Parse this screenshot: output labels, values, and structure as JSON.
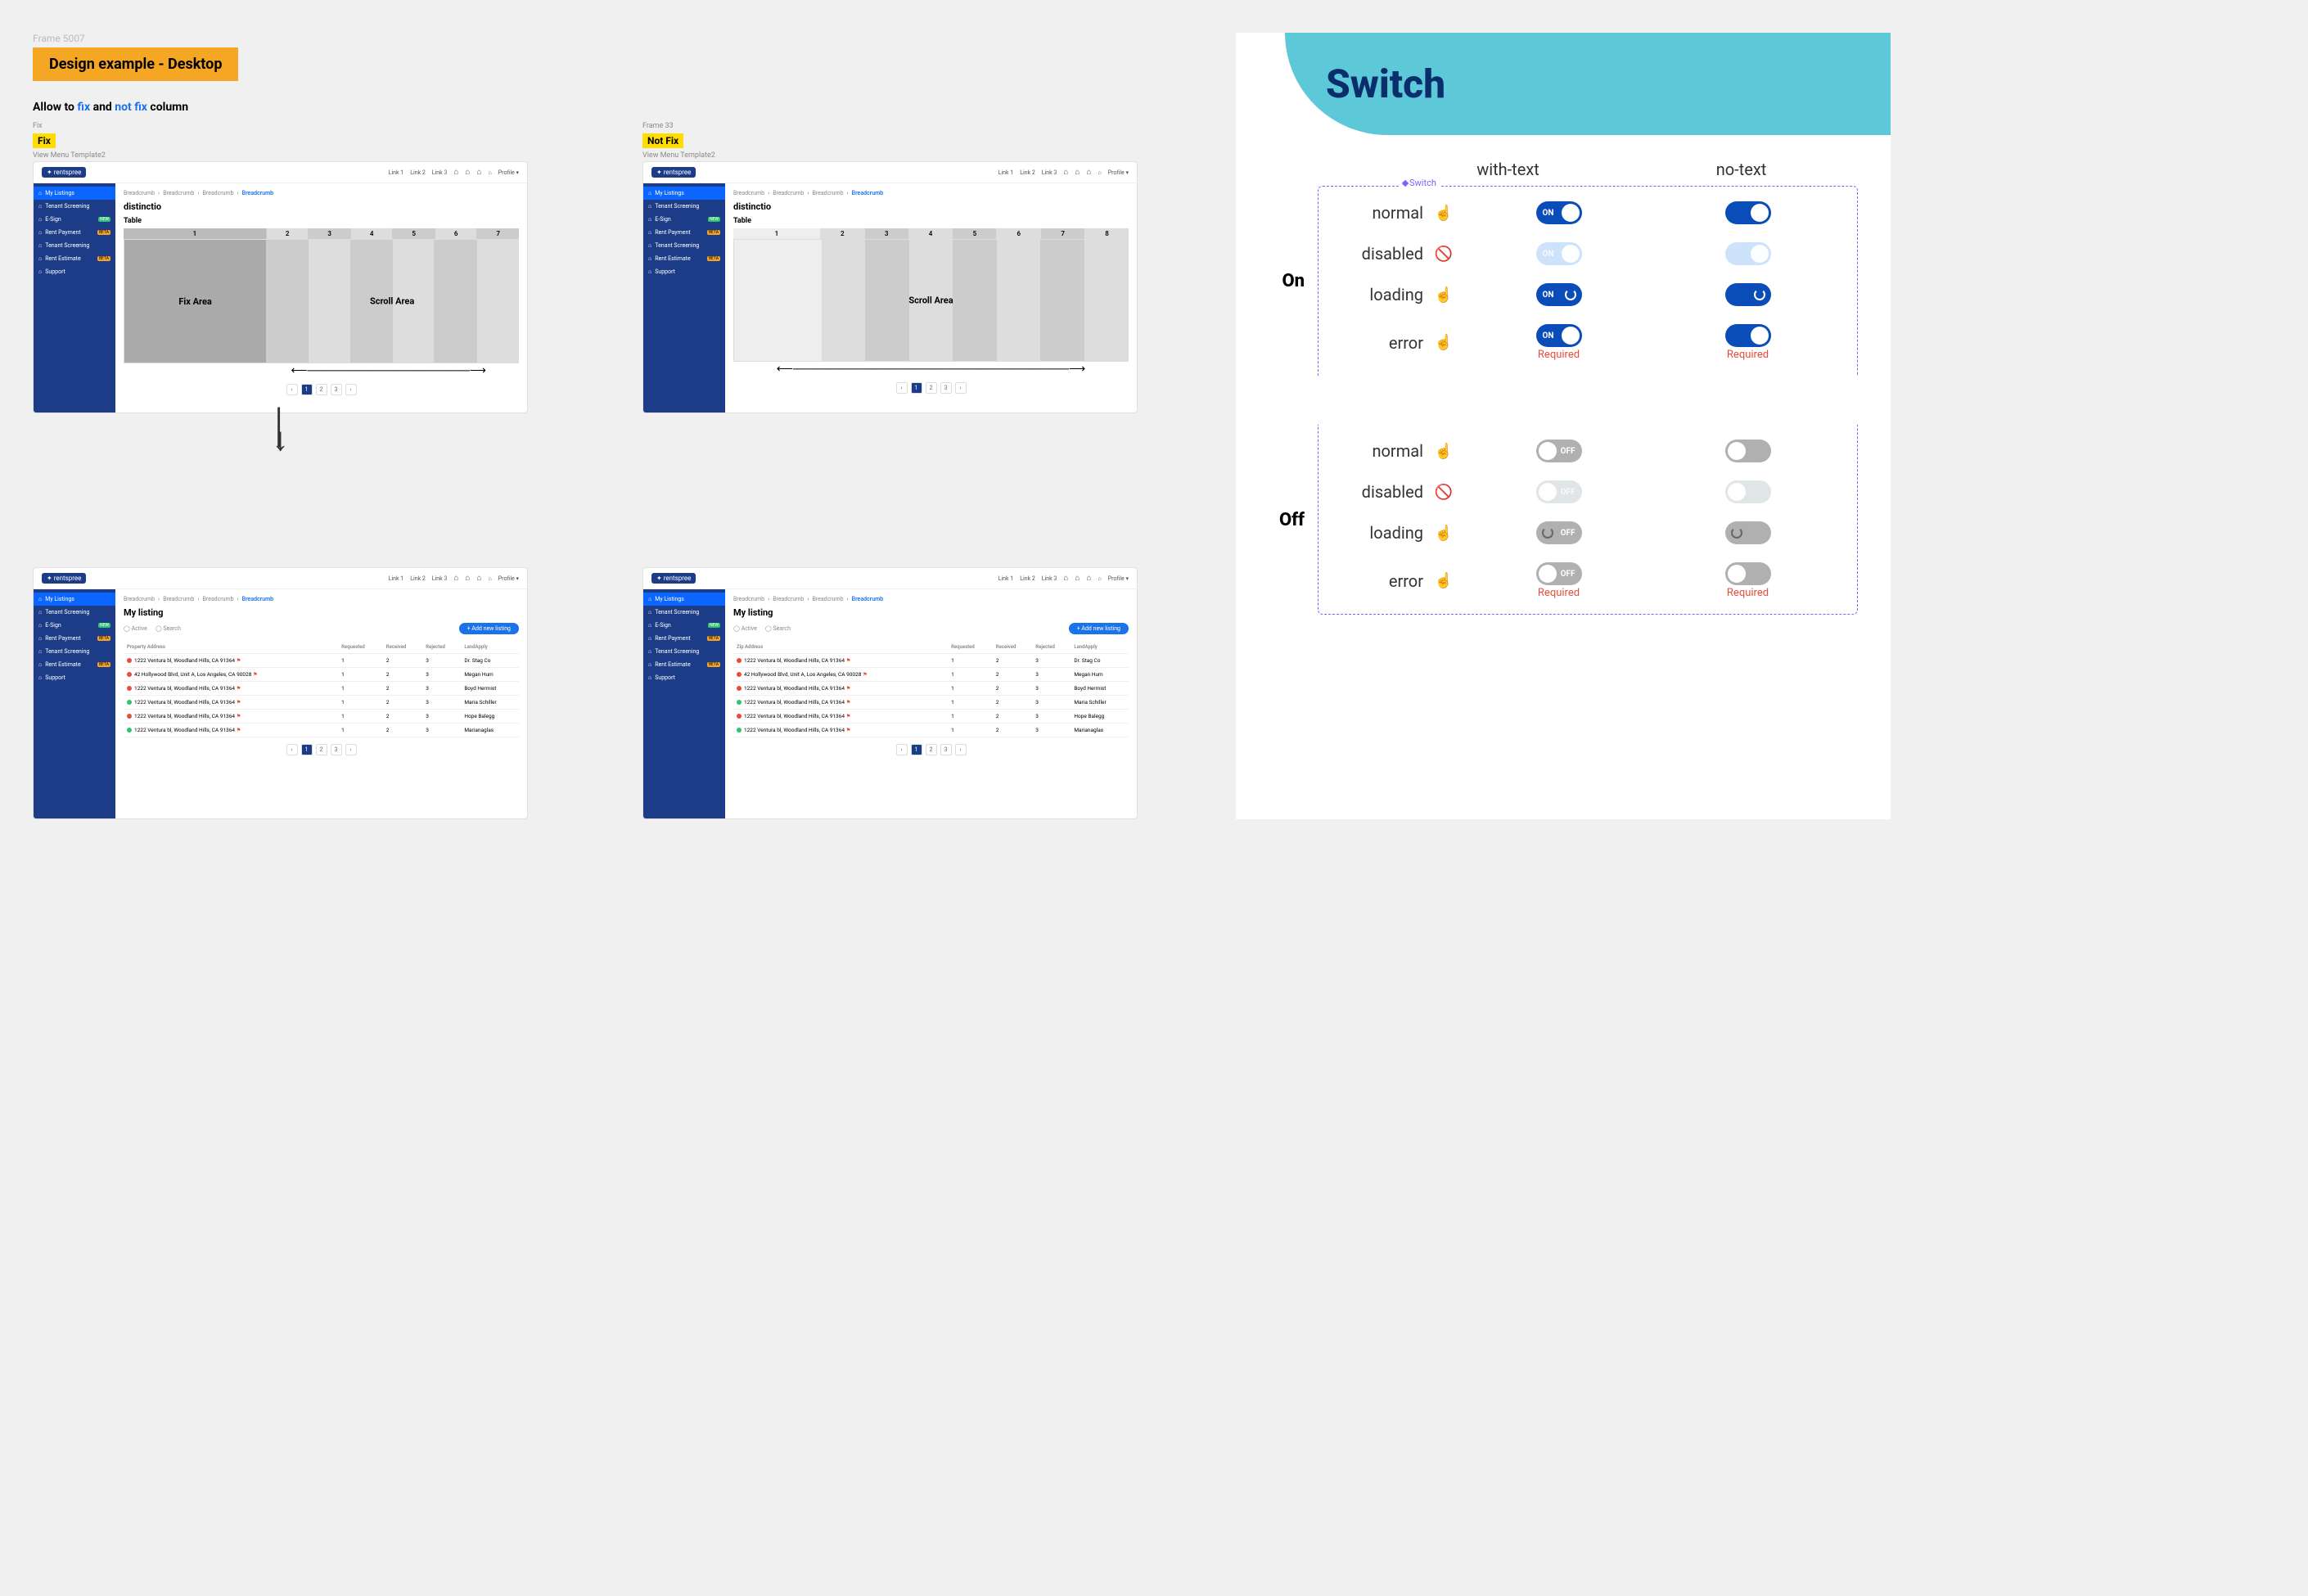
{
  "left": {
    "frame_label": "Frame 5007",
    "title": "Design example - Desktop",
    "subtitle_prefix": "Allow to",
    "subtitle_fix": "fix",
    "subtitle_and": "and",
    "subtitle_notfix": "not fix",
    "subtitle_suffix": "column",
    "fix_label": "Fix",
    "notfix_frame": "Frame 33",
    "notfix_label": "Not Fix",
    "view_label": "View Menu Template2",
    "brand": "rentspree",
    "top_links": [
      "Link 1",
      "Link 2",
      "Link 3"
    ],
    "profile": "Profile",
    "sidebar": [
      {
        "label": "My Listings",
        "active": true
      },
      {
        "label": "Tenant Screening"
      },
      {
        "label": "E-Sign",
        "badge": "NEW",
        "badge_class": "green"
      },
      {
        "label": "Rent Payment",
        "badge": "BETA"
      },
      {
        "label": "Tenant Screening"
      },
      {
        "label": "Rent Estimate",
        "badge": "BETA"
      },
      {
        "label": "Support"
      }
    ],
    "breadcrumbs": [
      "Breadcrumb",
      "Breadcrumb",
      "Breadcrumb",
      "Breadcrumb"
    ],
    "page_title": "distinctio",
    "table_label": "Table",
    "fix_area": "Fix Area",
    "scroll_area": "Scroll Area",
    "cols": [
      "1",
      "2",
      "3",
      "4",
      "5",
      "6",
      "7",
      "8"
    ],
    "pager": [
      "‹",
      "1",
      "2",
      "3",
      "›"
    ],
    "listing_title": "My listing",
    "filter_labels": [
      "Active",
      "Search"
    ],
    "add_btn": "+ Add new listing",
    "table_headers": [
      "Property Address",
      "",
      "Requested",
      "Received",
      "Rejected",
      "LandApply"
    ],
    "zip_label": "Zip Address",
    "rows": [
      {
        "addr": "1222 Ventura bl, Woodland Hills, CA 91364",
        "dot": "red",
        "r": 1,
        "c": 2,
        "j": 3,
        "who": "Dr. Stag Co"
      },
      {
        "addr": "42 Hollywood Blvd, Unit A, Los Angeles, CA 90028",
        "dot": "red",
        "r": 1,
        "c": 2,
        "j": 3,
        "who": "Megan Hum"
      },
      {
        "addr": "1222 Ventura bl, Woodland Hills, CA 91364",
        "dot": "red",
        "r": 1,
        "c": 2,
        "j": 3,
        "who": "Boyd Hermist"
      },
      {
        "addr": "1222 Ventura bl, Woodland Hills, CA 91364",
        "dot": "green",
        "r": 1,
        "c": 2,
        "j": 3,
        "who": "Maria Schiller"
      },
      {
        "addr": "1222 Ventura bl, Woodland Hills, CA 91364",
        "dot": "red",
        "r": 1,
        "c": 2,
        "j": 3,
        "who": "Hope Balegg"
      },
      {
        "addr": "1222 Ventura bl, Woodland Hills, CA 91364",
        "dot": "green",
        "r": 1,
        "c": 2,
        "j": 3,
        "who": "Marianaglas"
      }
    ]
  },
  "right": {
    "title": "Switch",
    "col_with_text": "with-text",
    "col_no_text": "no-text",
    "legend": "Switch",
    "groups": [
      {
        "name": "On",
        "rows": [
          "normal",
          "disabled",
          "loading",
          "error"
        ]
      },
      {
        "name": "Off",
        "rows": [
          "normal",
          "disabled",
          "loading",
          "error"
        ]
      }
    ],
    "on_text": "ON",
    "off_text": "OFF",
    "error_text": "Required"
  }
}
